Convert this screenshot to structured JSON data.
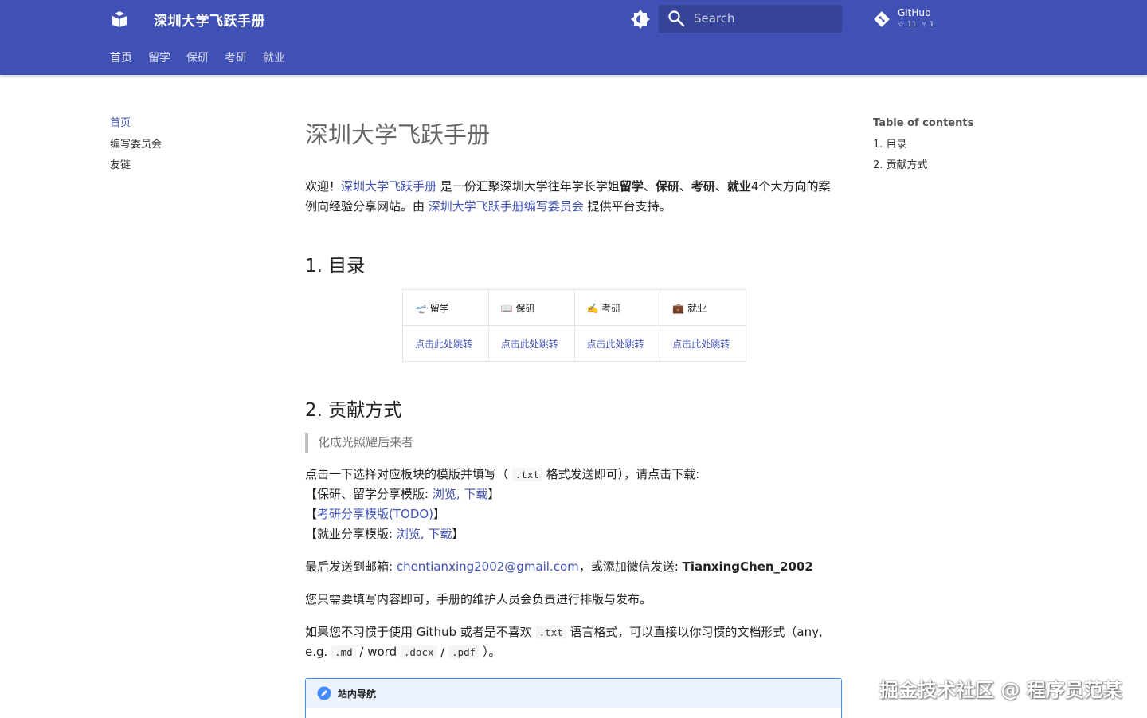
{
  "header": {
    "site_title": "深圳大学飞跃手册",
    "search_placeholder": "Search",
    "repo": {
      "name": "GitHub",
      "stars": "11",
      "forks": "1"
    },
    "tabs": [
      "首页",
      "留学",
      "保研",
      "考研",
      "就业"
    ],
    "accent_color": "#4051b5"
  },
  "left_nav": {
    "items": [
      "首页",
      "编写委员会",
      "友链"
    ]
  },
  "toc": {
    "title": "Table of contents",
    "items": [
      "1. 目录",
      "2. 贡献方式"
    ]
  },
  "content": {
    "title": "深圳大学飞跃手册",
    "intro": {
      "prefix": "欢迎！",
      "link1": "深圳大学飞跃手册",
      "mid1": " 是一份汇聚深圳大学往年学长学姐",
      "bold1": "留学",
      "sep1": "、",
      "bold2": "保研",
      "sep2": "、",
      "bold3": "考研",
      "sep3": "、",
      "bold4": "就业",
      "mid2": "4个大方向的案例向经验分享网站。由 ",
      "link2": "深圳大学飞跃手册编写委员会",
      "suffix": " 提供平台支持。"
    },
    "section1_title": "1. 目录",
    "directory_table": {
      "headers": [
        "🛫 留学",
        "📖 保研",
        "✍️ 考研",
        "💼 就业"
      ],
      "links": [
        "点击此处跳转",
        "点击此处跳转",
        "点击此处跳转",
        "点击此处跳转"
      ]
    },
    "section2_title": "2. 贡献方式",
    "quote": "化成光照耀后来者",
    "contrib": {
      "line1_prefix": "点击一下选择对应板块的模版并填写（ ",
      "line1_code": ".txt",
      "line1_suffix": " 格式发送即可），请点击下载:",
      "line2_prefix": "【保研、留学分享模版: ",
      "line2_view": "浏览",
      "line2_comma": ", ",
      "line2_download": "下载",
      "line2_suffix": "】",
      "line3_prefix": "【",
      "line3_link": "考研分享模版(TODO)",
      "line3_suffix": "】",
      "line4_prefix": "【就业分享模版: ",
      "line4_view": "浏览",
      "line4_comma": ", ",
      "line4_download": "下载",
      "line4_suffix": "】"
    },
    "email": {
      "prefix": "最后发送到邮箱: ",
      "address": "chentianxing2002@gmail.com",
      "mid": "，或添加微信发送: ",
      "wechat": "TianxingChen_2002"
    },
    "note1": "您只需要填写内容即可，手册的维护人员会负责进行排版与发布。",
    "note2": {
      "prefix": "如果您不习惯于使用 Github 或者是不喜欢 ",
      "code1": ".txt",
      "mid": " 语言格式，可以直接以你习惯的文档形式（any, e.g. ",
      "code2": ".md",
      "sep1": " / word ",
      "code3": ".docx",
      "sep2": " / ",
      "code4": ".pdf",
      "suffix": " ）。"
    },
    "admonition_title": "站内导航"
  },
  "watermark": "掘金技术社区 @ 程序员范某"
}
